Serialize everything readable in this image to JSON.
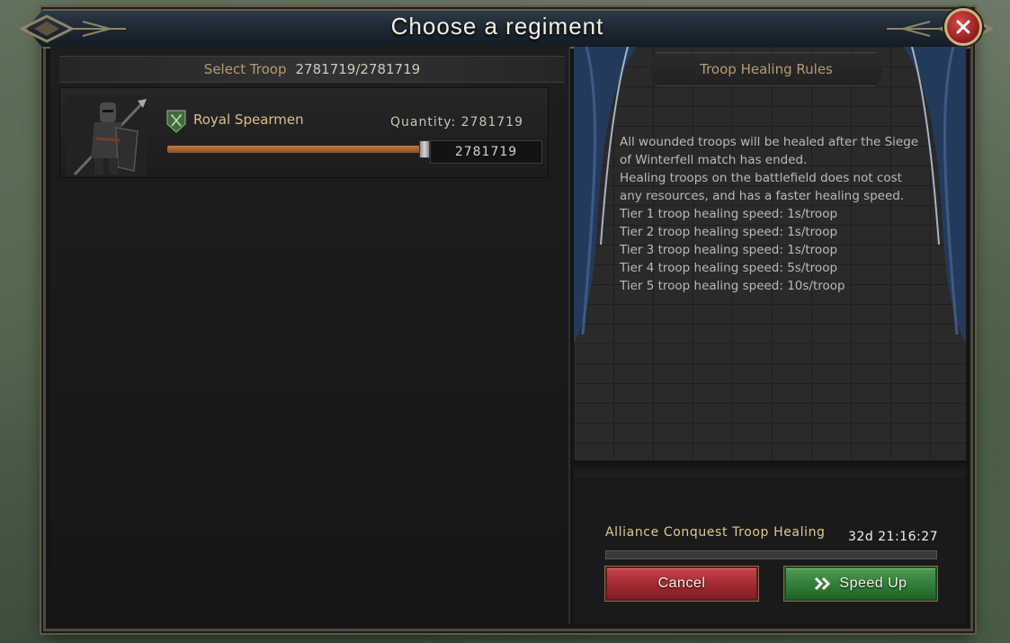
{
  "dialog": {
    "title": "Choose a regiment"
  },
  "select_troop": {
    "label": "Select Troop",
    "count": "2781719/2781719"
  },
  "troops": [
    {
      "name": "Royal Spearmen",
      "quantity_label": "Quantity: 2781719",
      "quantity_value": "2781719",
      "slider_fraction": 1.0
    }
  ],
  "rules": {
    "title": "Troop Healing Rules",
    "lines": [
      "All wounded troops will be healed after the Siege",
      "of Winterfell match has ended.",
      "Healing troops on the battlefield does not cost",
      "any resources, and has a faster healing speed.",
      "Tier 1 troop healing speed: 1s/troop",
      "Tier 2 troop healing speed: 1s/troop",
      "Tier 3 troop healing speed: 1s/troop",
      "Tier 4 troop healing speed: 5s/troop",
      "Tier 5 troop healing speed: 10s/troop"
    ]
  },
  "healing": {
    "label": "Alliance Conquest Troop Healing",
    "timer": "32d 21:16:27",
    "progress": 0
  },
  "buttons": {
    "cancel": "Cancel",
    "speed_up": "Speed Up"
  },
  "colors": {
    "accent_gold": "#b39c72",
    "cancel_red": "#9e2730",
    "speed_green": "#2f7a34",
    "slider_orange": "#c07a3e"
  },
  "icons": {
    "close": "close-icon",
    "badge": "spear-badge-icon",
    "speed": "double-chevron-icon"
  }
}
